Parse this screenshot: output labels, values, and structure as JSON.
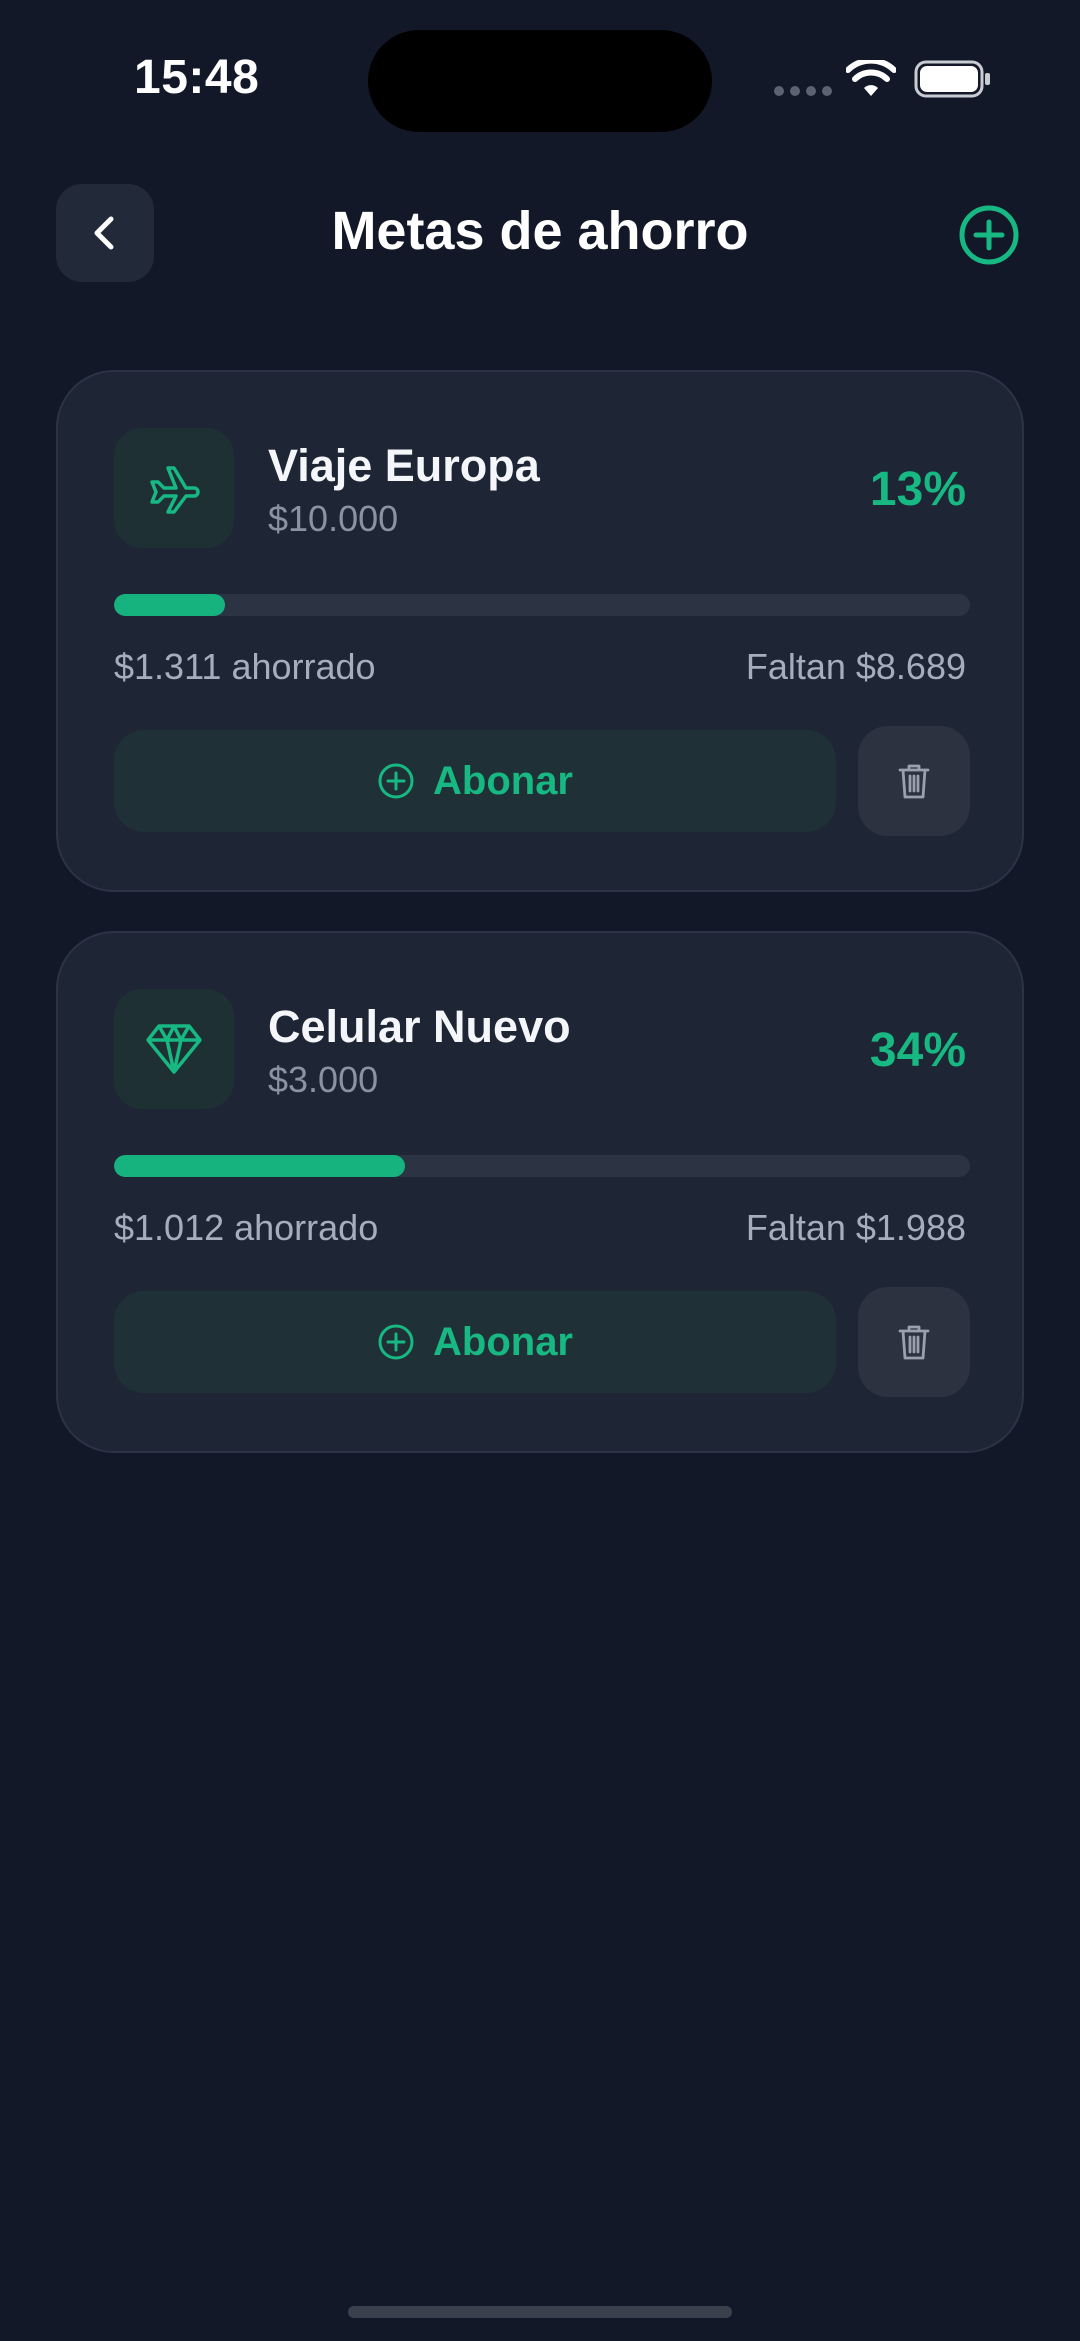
{
  "status_bar": {
    "time": "15:48"
  },
  "header": {
    "title": "Metas de ahorro"
  },
  "goals": [
    {
      "name": "Viaje Europa",
      "target": "$10.000",
      "percent": "13%",
      "progress": 0.13,
      "saved": "$1.311 ahorrado",
      "remaining": "Faltan $8.689",
      "icon": "airplane-icon",
      "action_label": "Abonar"
    },
    {
      "name": "Celular Nuevo",
      "target": "$3.000",
      "percent": "34%",
      "progress": 0.34,
      "saved": "$1.012 ahorrado",
      "remaining": "Faltan $1.988",
      "icon": "diamond-icon",
      "action_label": "Abonar"
    }
  ],
  "colors": {
    "background": "#131828",
    "card": "#1e2535",
    "accent": "#17b882",
    "muted_text": "#a7aebb"
  }
}
